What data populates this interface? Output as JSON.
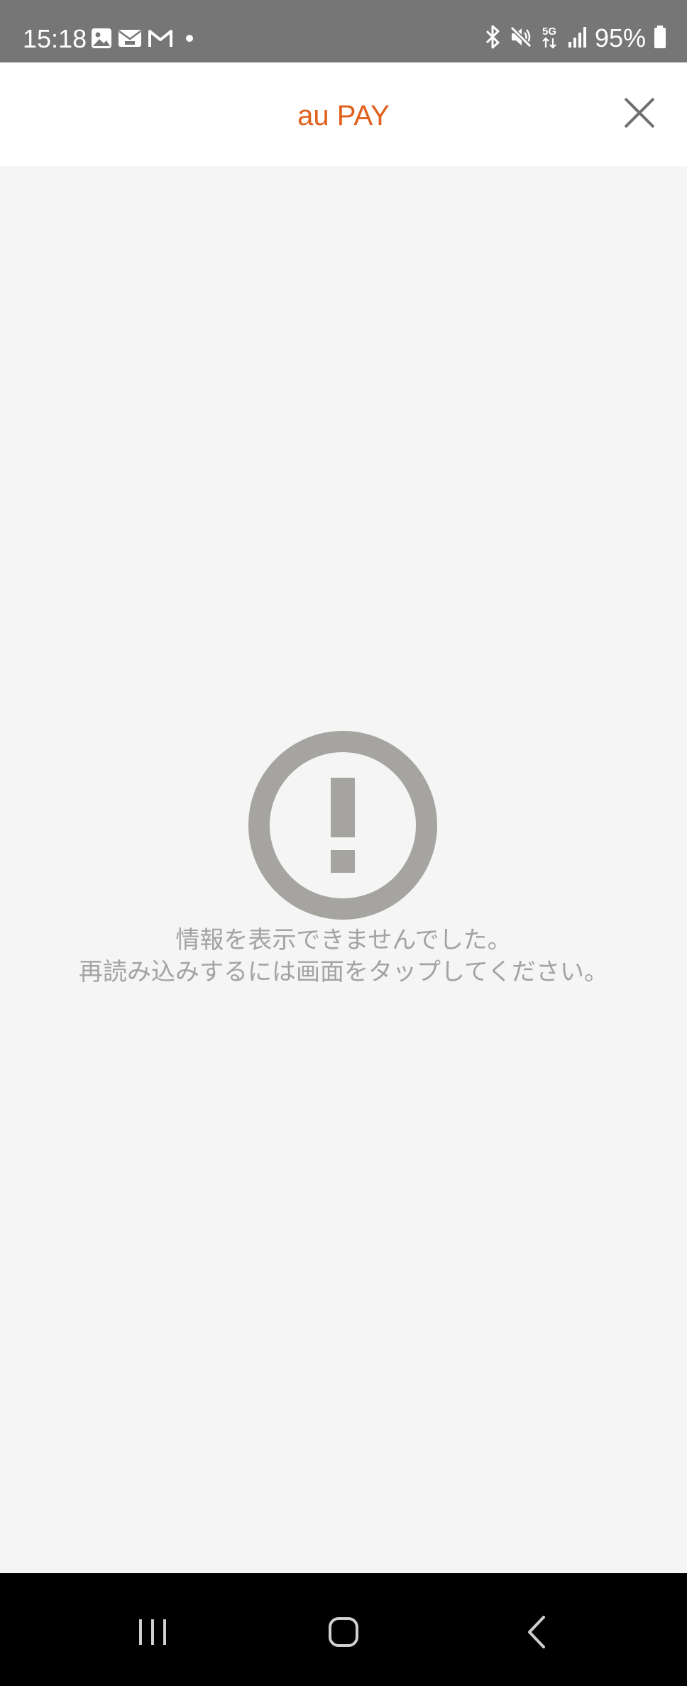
{
  "status_bar": {
    "time": "15:18",
    "battery": "95%",
    "left_icons": [
      "gallery-icon",
      "au-mail-icon",
      "gmail-icon",
      "dot-icon"
    ],
    "right_icons": [
      "bluetooth-icon",
      "mute-icon",
      "5g-icon",
      "signal-icon",
      "battery-icon"
    ]
  },
  "header": {
    "title": "au PAY",
    "title_color": "#e0601c",
    "close_icon": "close-icon"
  },
  "error": {
    "icon": "exclamation-circle-icon",
    "icon_color": "#a5a4a0",
    "line1": "情報を表示できませんでした。",
    "line2": "再読み込みするには画面をタップしてください。"
  },
  "nav_bar": {
    "icons": [
      "recent-apps-icon",
      "home-icon",
      "back-icon"
    ]
  }
}
